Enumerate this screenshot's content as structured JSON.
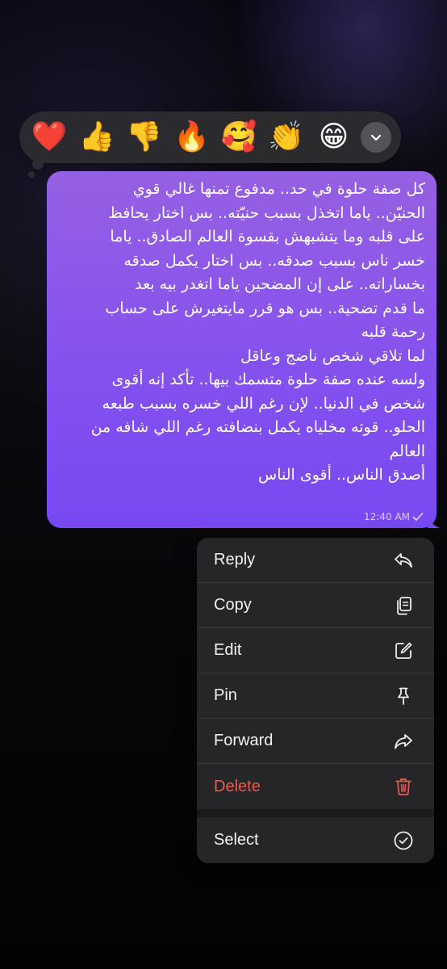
{
  "reactions": [
    {
      "emoji": "❤️",
      "icon": "red-heart-icon"
    },
    {
      "emoji": "👍",
      "icon": "thumbs-up-icon"
    },
    {
      "emoji": "👎",
      "icon": "thumbs-down-icon"
    },
    {
      "emoji": "🔥",
      "icon": "fire-icon"
    },
    {
      "emoji": "🥰",
      "icon": "smiling-face-hearts-icon"
    },
    {
      "emoji": "👏",
      "icon": "clapping-hands-icon"
    },
    {
      "emoji": "😁",
      "icon": "beaming-face-icon"
    }
  ],
  "message": {
    "lines": [
      "كل صفة حلوة في حد.. مدفوع تمنها غالي قوي",
      "الحنيّن.. ياما اتخذل بسبب حنيّته.. بس اختار يحافظ",
      "على قلبه وما يتشبهش بقسوة العالم الصادق.. ياما",
      "خسر ناس بسبب صدقه.. بس اختار يكمل صدقه",
      "بخساراته.. على إن المضحين ياما اتغدر بيه بعد",
      "ما قدم تضحية.. بس هو قرر مايتغيرش على حساب",
      "رحمة قلبه",
      "لما تلاقي شخص ناضج وعاقل",
      "ولسه عنده صفة حلوة متسمك بيها.. تأكد إنه أقوى",
      "شخص في الدنيا.. لإن رغم اللي خسره بسبب طبعه",
      "الحلو.. قوته مخلياه يكمل بنضافته رغم اللي شافه من",
      "العالم",
      "أصدق الناس.. أقوى الناس"
    ],
    "time": "12:40 AM"
  },
  "menu": {
    "reply": "Reply",
    "copy": "Copy",
    "edit": "Edit",
    "pin": "Pin",
    "forward": "Forward",
    "delete": "Delete",
    "select": "Select"
  },
  "colors": {
    "bubble_top": "#9660e2",
    "bubble_bottom": "#7849f3",
    "menu_bg": "#262628",
    "delete": "#e75a4e"
  }
}
